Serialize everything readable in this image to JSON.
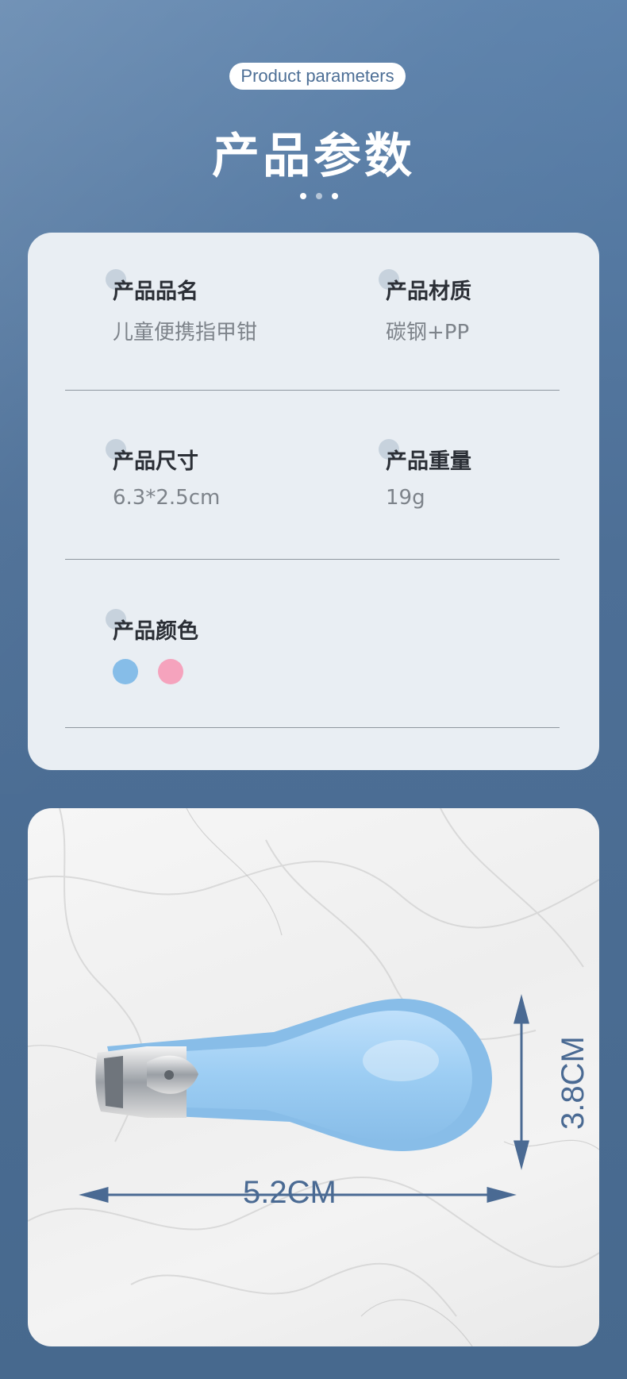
{
  "header": {
    "subtitle": "Product parameters",
    "title": "产品参数"
  },
  "params": [
    {
      "label": "产品品名",
      "value": "儿童便携指甲钳"
    },
    {
      "label": "产品材质",
      "value": "碳钢+PP"
    },
    {
      "label": "产品尺寸",
      "value": "6.3*2.5cm"
    },
    {
      "label": "产品重量",
      "value": "19g"
    },
    {
      "label": "产品颜色"
    }
  ],
  "colors": {
    "swatch_blue": "#86bde8",
    "swatch_pink": "#f5a3bd",
    "accent": "#4d6f96"
  },
  "dimensions": {
    "width_label": "5.2CM",
    "height_label": "3.8CM"
  }
}
